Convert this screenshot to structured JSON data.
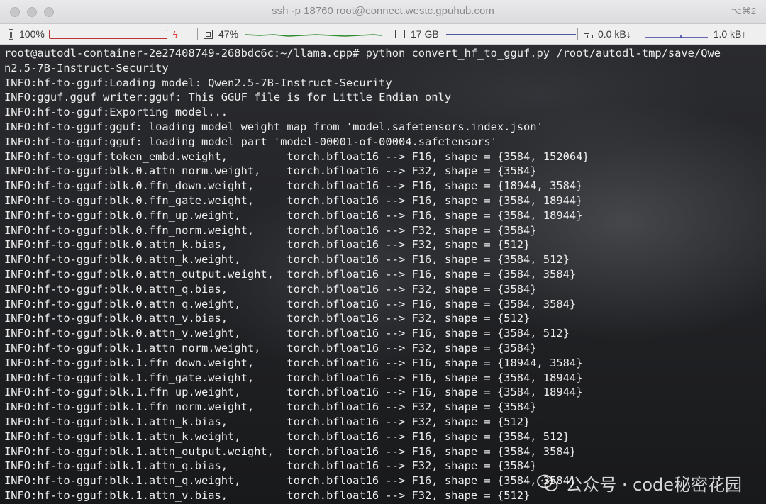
{
  "window": {
    "title": "ssh -p 18760 root@connect.westc.gpuhub.com",
    "shortcut": "⌥⌘2"
  },
  "statusbar": {
    "battery": "100%",
    "cpu": "47%",
    "memory": "17 GB",
    "net_down": "0.0 kB↓",
    "net_up": "1.0 kB↑",
    "colors": {
      "battery_bar": "#b33333",
      "cpu_graph": "#2e8b2e",
      "mem_bar": "#4b5a9b"
    }
  },
  "terminal": {
    "lines": [
      "root@autodl-container-2e27408749-268bdc6c:~/llama.cpp# python convert_hf_to_gguf.py /root/autodl-tmp/save/Qwe",
      "n2.5-7B-Instruct-Security",
      "INFO:hf-to-gguf:Loading model: Qwen2.5-7B-Instruct-Security",
      "INFO:gguf.gguf_writer:gguf: This GGUF file is for Little Endian only",
      "INFO:hf-to-gguf:Exporting model...",
      "INFO:hf-to-gguf:gguf: loading model weight map from 'model.safetensors.index.json'",
      "INFO:hf-to-gguf:gguf: loading model part 'model-00001-of-00004.safetensors'",
      "INFO:hf-to-gguf:token_embd.weight,         torch.bfloat16 --> F16, shape = {3584, 152064}",
      "INFO:hf-to-gguf:blk.0.attn_norm.weight,    torch.bfloat16 --> F32, shape = {3584}",
      "INFO:hf-to-gguf:blk.0.ffn_down.weight,     torch.bfloat16 --> F16, shape = {18944, 3584}",
      "INFO:hf-to-gguf:blk.0.ffn_gate.weight,     torch.bfloat16 --> F16, shape = {3584, 18944}",
      "INFO:hf-to-gguf:blk.0.ffn_up.weight,       torch.bfloat16 --> F16, shape = {3584, 18944}",
      "INFO:hf-to-gguf:blk.0.ffn_norm.weight,     torch.bfloat16 --> F32, shape = {3584}",
      "INFO:hf-to-gguf:blk.0.attn_k.bias,         torch.bfloat16 --> F32, shape = {512}",
      "INFO:hf-to-gguf:blk.0.attn_k.weight,       torch.bfloat16 --> F16, shape = {3584, 512}",
      "INFO:hf-to-gguf:blk.0.attn_output.weight,  torch.bfloat16 --> F16, shape = {3584, 3584}",
      "INFO:hf-to-gguf:blk.0.attn_q.bias,         torch.bfloat16 --> F32, shape = {3584}",
      "INFO:hf-to-gguf:blk.0.attn_q.weight,       torch.bfloat16 --> F16, shape = {3584, 3584}",
      "INFO:hf-to-gguf:blk.0.attn_v.bias,         torch.bfloat16 --> F32, shape = {512}",
      "INFO:hf-to-gguf:blk.0.attn_v.weight,       torch.bfloat16 --> F16, shape = {3584, 512}",
      "INFO:hf-to-gguf:blk.1.attn_norm.weight,    torch.bfloat16 --> F32, shape = {3584}",
      "INFO:hf-to-gguf:blk.1.ffn_down.weight,     torch.bfloat16 --> F16, shape = {18944, 3584}",
      "INFO:hf-to-gguf:blk.1.ffn_gate.weight,     torch.bfloat16 --> F16, shape = {3584, 18944}",
      "INFO:hf-to-gguf:blk.1.ffn_up.weight,       torch.bfloat16 --> F16, shape = {3584, 18944}",
      "INFO:hf-to-gguf:blk.1.ffn_norm.weight,     torch.bfloat16 --> F32, shape = {3584}",
      "INFO:hf-to-gguf:blk.1.attn_k.bias,         torch.bfloat16 --> F32, shape = {512}",
      "INFO:hf-to-gguf:blk.1.attn_k.weight,       torch.bfloat16 --> F16, shape = {3584, 512}",
      "INFO:hf-to-gguf:blk.1.attn_output.weight,  torch.bfloat16 --> F16, shape = {3584, 3584}",
      "INFO:hf-to-gguf:blk.1.attn_q.bias,         torch.bfloat16 --> F32, shape = {3584}",
      "INFO:hf-to-gguf:blk.1.attn_q.weight,       torch.bfloat16 --> F16, shape = {3584, 3584}",
      "INFO:hf-to-gguf:blk.1.attn_v.bias,         torch.bfloat16 --> F32, shape = {512}"
    ]
  },
  "watermark": {
    "text": "公众号 · code秘密花园",
    "icon": "wechat-icon"
  }
}
